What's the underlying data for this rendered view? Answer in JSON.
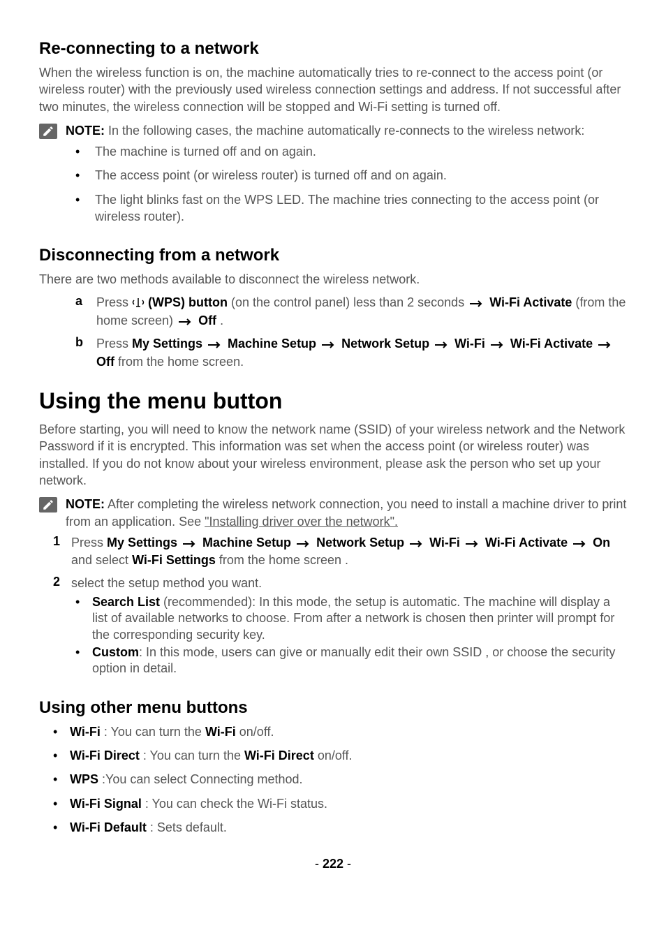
{
  "section1": {
    "heading": "Re-connecting to a network",
    "para": "When the wireless function is on, the machine automatically tries to re-connect to the access point (or wireless router) with the previously used wireless connection settings and address. If not successful after two minutes, the wireless connection will be stopped and Wi-Fi setting is turned off.",
    "note_label": "NOTE:",
    "note_text": " In the following cases, the machine automatically re-connects to the wireless network:",
    "bullets": [
      "The machine is turned off and on again.",
      "The access point (or wireless router) is turned off and on again.",
      "The light blinks fast on the WPS LED. The machine tries connecting to the access point (or wireless router)."
    ]
  },
  "section2": {
    "heading": "Disconnecting from a network",
    "para": "There are two methods available to disconnect the wireless network.",
    "item_a": {
      "marker": "a",
      "press": "Press ",
      "wps_button": " (WPS) button",
      "on_panel": " (on the control panel) less than 2 seconds ",
      "wifi_activate": " Wi-Fi Activate",
      "from_home": " (from the home screen) ",
      "off": " Off",
      "end": " ."
    },
    "item_b": {
      "marker": "b",
      "press": "Press ",
      "my_settings": "My Settings ",
      "machine_setup": " Machine Setup ",
      "network_setup": " Network Setup ",
      "wifi": " Wi-Fi ",
      "wifi_activate": " Wi-Fi Activate ",
      "off": " Off",
      "from_home": " from the home screen."
    }
  },
  "section3": {
    "heading": "Using the menu button",
    "para": "Before starting, you will need to know the network name (SSID) of your wireless network and the Network Password if it is encrypted. This information was set when the access point (or wireless router) was installed. If you do not know about your wireless environment, please ask the person who set up your network.",
    "note_label": "NOTE:",
    "note_text": " After completing the wireless network connection, you need to install a machine driver to print from an application. See ",
    "note_link": "\"Installing driver over the network\".",
    "step1": {
      "marker": "1",
      "press": "Press ",
      "my_settings": "My Settings ",
      "machine_setup": " Machine Setup ",
      "network_setup": " Network Setup ",
      "wifi": " Wi-Fi ",
      "wifi_activate": " Wi-Fi Activate ",
      "on": " On",
      "and_select": " and select ",
      "wifi_settings": "Wi-Fi Settings",
      "from_home": " from the home screen ."
    },
    "step2": {
      "marker": "2",
      "text": "select the setup method you want.",
      "search_label": "Search List",
      "search_text": " (recommended): In this mode, the setup is automatic. The machine will display a list of available networks to choose. From after a network is chosen then printer will prompt for the corresponding security key.",
      "custom_label": "Custom",
      "custom_text": ": In this mode, users can give or manually edit their own SSID , or choose the security option in detail."
    }
  },
  "section4": {
    "heading": "Using other menu buttons",
    "items": [
      {
        "label": "Wi-Fi",
        "text": " : You can turn the ",
        "bold2": "Wi-Fi",
        "text2": " on/off."
      },
      {
        "label": "Wi-Fi Direct",
        "text": " : You can turn the ",
        "bold2": "Wi-Fi Direct",
        "text2": " on/off."
      },
      {
        "label": "WPS",
        "text": " :You can select Connecting method.",
        "bold2": "",
        "text2": ""
      },
      {
        "label": "Wi-Fi Signal",
        "text": " : You can check the Wi-Fi status.",
        "bold2": "",
        "text2": ""
      },
      {
        "label": "Wi-Fi Default",
        "text": " : Sets default.",
        "bold2": "",
        "text2": ""
      }
    ]
  },
  "page": {
    "dash": "- ",
    "number": "222",
    "dash2": " -"
  }
}
